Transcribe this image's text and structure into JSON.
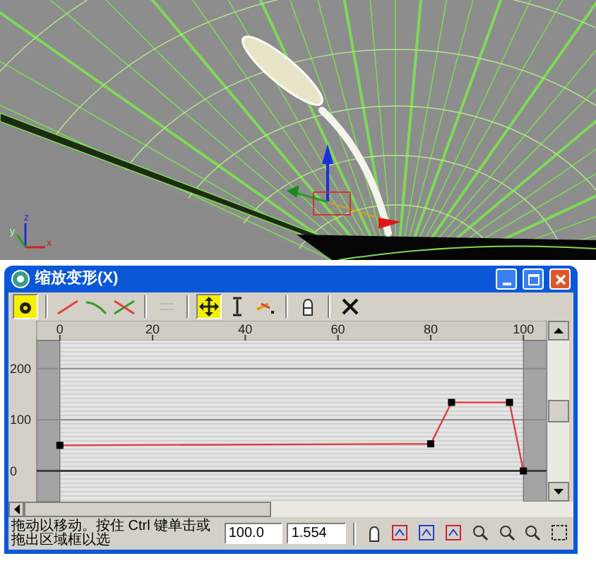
{
  "viewport": {
    "axis_labels": [
      "z",
      "y",
      "x"
    ]
  },
  "window": {
    "title": "缩放变形(X)"
  },
  "toolbar": [
    {
      "selected": true,
      "disabled": false
    },
    {
      "selected": false,
      "disabled": false
    },
    {
      "selected": false,
      "disabled": false
    },
    {
      "selected": false,
      "disabled": false
    },
    {
      "selected": false,
      "disabled": true
    },
    {
      "selected": true,
      "disabled": false
    },
    {
      "selected": false,
      "disabled": false
    },
    {
      "selected": false,
      "disabled": false
    },
    {
      "selected": false,
      "disabled": false
    },
    {
      "selected": false,
      "disabled": false
    }
  ],
  "graph": {
    "chart_data": {
      "type": "line",
      "x": [
        0,
        80,
        84.5,
        97,
        100
      ],
      "series": [
        {
          "color": "#e03c3c",
          "marker": "square",
          "values": [
            50,
            53,
            134,
            134,
            0
          ]
        }
      ],
      "xlim": [
        -5,
        105
      ],
      "ylim": [
        -60,
        255
      ],
      "grid": true,
      "xticks": [
        0,
        20,
        40,
        60,
        80,
        100
      ],
      "yticks": [
        0,
        100,
        200
      ]
    }
  },
  "status_bar": {
    "prompt": "拖动以移动。按住 Ctrl 键单击或拖出区域框以选",
    "x_value": "100.0",
    "y_value": "1.554"
  },
  "status_tools": [
    {
      "selected": false
    },
    {
      "selected": false
    },
    {
      "selected": false
    },
    {
      "selected": false
    },
    {
      "selected": false
    },
    {
      "selected": false
    },
    {
      "selected": false
    },
    {
      "selected": false
    }
  ]
}
